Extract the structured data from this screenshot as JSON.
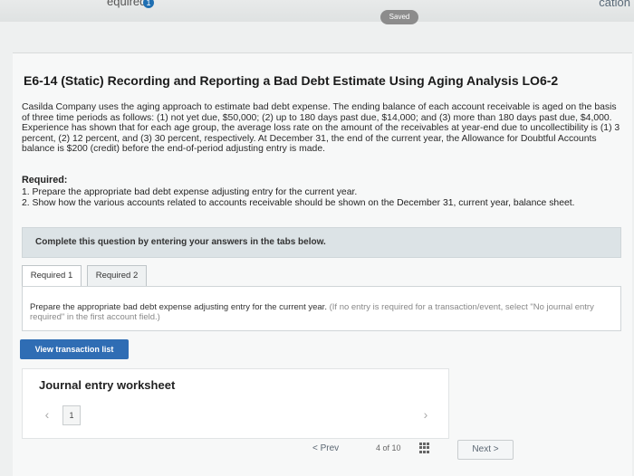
{
  "topbar": {
    "required_label": "equired",
    "badge": "1",
    "brand": "cation"
  },
  "status": {
    "saved": "Saved"
  },
  "problem": {
    "title": "E6-14 (Static) Recording and Reporting a Bad Debt Estimate Using Aging Analysis LO6-2",
    "text": "Casilda Company uses the aging approach to estimate bad debt expense. The ending balance of each account receivable is aged on the basis of three time periods as follows: (1) not yet due, $50,000; (2) up to 180 days past due, $14,000; and (3) more than 180 days past due, $4,000. Experience has shown that for each age group, the average loss rate on the amount of the receivables at year-end due to uncollectibility is (1) 3 percent, (2) 12 percent, and (3) 30 percent, respectively. At December 31, the end of the current year, the Allowance for Doubtful Accounts balance is $200 (credit) before the end-of-period adjusting entry is made.",
    "required_title": "Required:",
    "requirements": [
      "1. Prepare the appropriate bad debt expense adjusting entry for the current year.",
      "2. Show how the various accounts related to accounts receivable should be shown on the December 31, current year, balance sheet."
    ]
  },
  "instructions": {
    "complete": "Complete this question by entering your answers in the tabs below."
  },
  "tabs": [
    {
      "label": "Required 1"
    },
    {
      "label": "Required 2"
    }
  ],
  "panel": {
    "instruction": "Prepare the appropriate bad debt expense adjusting entry for the current year.",
    "hint": "(If no entry is required for a transaction/event, select \"No journal entry required\" in the first account field.)"
  },
  "buttons": {
    "view_transaction_list": "View transaction list"
  },
  "worksheet": {
    "title": "Journal entry worksheet",
    "page": "1",
    "prev_icon": "‹",
    "next_icon": "›"
  },
  "pager": {
    "prev": "< Prev",
    "count": "4 of 10",
    "next": "Next >"
  }
}
